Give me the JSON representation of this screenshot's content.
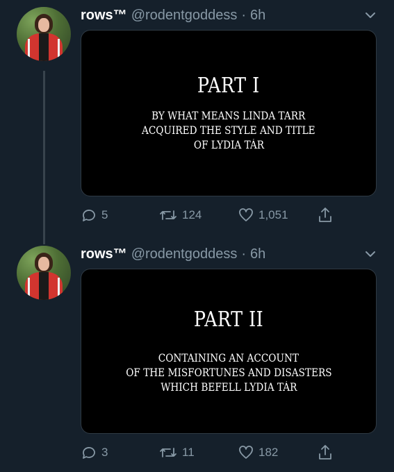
{
  "tweets": [
    {
      "display_name": "rows™",
      "handle": "@rodentgoddess",
      "separator": "·",
      "time": "6h",
      "card": {
        "title": "PART I",
        "lines": [
          "BY WHAT MEANS LINDA TARR",
          "ACQUIRED THE STYLE AND TITLE",
          "OF LYDIA TÁR"
        ]
      },
      "stats": {
        "replies": "5",
        "retweets": "124",
        "likes": "1,051"
      }
    },
    {
      "display_name": "rows™",
      "handle": "@rodentgoddess",
      "separator": "·",
      "time": "6h",
      "card": {
        "title": "PART II",
        "lines": [
          "CONTAINING AN ACCOUNT",
          "OF THE MISFORTUNES AND DISASTERS",
          "WHICH BEFELL LYDIA TÁR"
        ]
      },
      "stats": {
        "replies": "3",
        "retweets": "11",
        "likes": "182"
      }
    }
  ],
  "icons": {
    "reply": "reply-icon",
    "retweet": "retweet-icon",
    "like": "heart-icon",
    "share": "share-icon",
    "more": "chevron-down-icon"
  },
  "colors": {
    "background": "#15202b",
    "secondary_text": "#8899a6",
    "card_background": "#000000",
    "thread_line": "#38444d"
  }
}
